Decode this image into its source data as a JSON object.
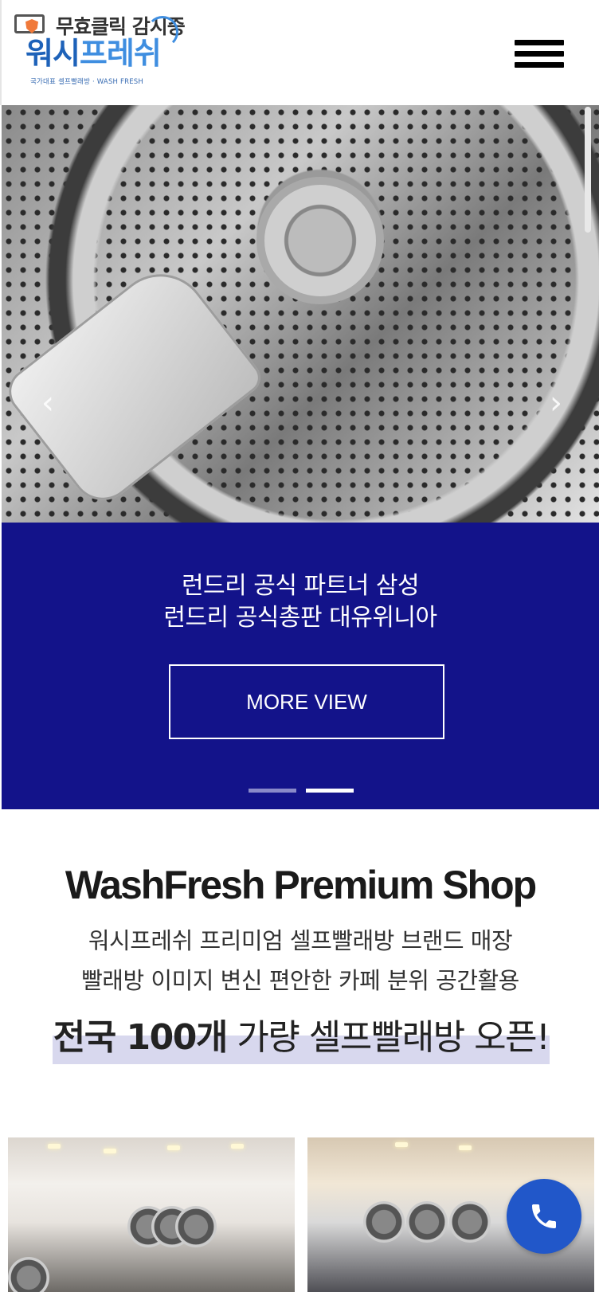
{
  "header": {
    "logo_watch_text": "무효클릭 감시중",
    "logo_brand_part1": "워시",
    "logo_brand_part2": "프레쉬",
    "logo_subtitle": "국가대표 셀프빨래방 · WASH FRESH",
    "menu_icon": "hamburger-icon"
  },
  "hero": {
    "prev_icon": "chevron-left-icon",
    "next_icon": "chevron-right-icon",
    "prev_glyph": "‹",
    "next_glyph": "›"
  },
  "promo": {
    "line1": "런드리 공식 파트너 삼성",
    "line2": "런드리 공식총판 대유위니아",
    "button_label": "MORE VIEW",
    "background_color": "#13138a",
    "slides_count": 2,
    "active_slide": 2
  },
  "shop": {
    "title": "WashFresh Premium Shop",
    "line1": "워시프레쉬 프리미엄 셀프빨래방 브랜드 매장",
    "line2": "빨래방 이미지 변신 편안한 카페 분위 공간활용",
    "highlight_bold": "전국 100개",
    "highlight_rest": " 가량 셀프빨래방 오픈!"
  },
  "call_button": {
    "icon": "phone-icon",
    "color": "#2157c9"
  }
}
